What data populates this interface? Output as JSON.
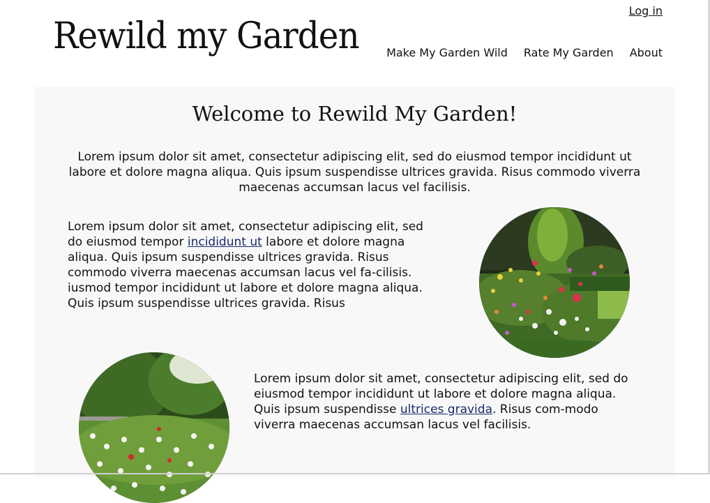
{
  "header": {
    "login_label": "Log in",
    "logo_text": "Rewild my Garden",
    "nav": [
      "Make My Garden Wild",
      "Rate My Garden",
      "About"
    ]
  },
  "main": {
    "title": "Welcome to Rewild My Garden!",
    "intro": "Lorem ipsum dolor sit amet, consectetur adipiscing elit, sed do eiusmod tempor incididunt ut labore et dolore magna aliqua. Quis ipsum suspendisse ultrices gravida. Risus commodo viverra maecenas accumsan lacus vel facilisis.",
    "section1": {
      "text_a": "Lorem ipsum dolor sit amet, consectetur adipiscing elit, sed do eiusmod tempor ",
      "link": "incididunt ut",
      "text_b": " labore et dolore magna aliqua. Quis ipsum suspendisse ultrices gravida. Risus commodo viverra maecenas accumsan lacus vel fa-cilisis.",
      "text_c": "iusmod tempor incididunt ut labore et dolore magna aliqua. Quis ipsum suspendisse ultrices gravida. Risus"
    },
    "section2": {
      "text_a": "Lorem ipsum dolor sit amet, consectetur adipiscing elit, sed do eiusmod tempor incididunt ut labore et dolore magna aliqua. Quis ipsum suspendisse ",
      "link": "ultrices gravida",
      "text_b": ". Risus com-modo viverra maecenas accumsan lacus vel facilisis."
    }
  },
  "colors": {
    "content_bg": "#f8f8f9",
    "link": "#1b2a6b",
    "text": "#111111"
  },
  "images": [
    "flower-garden-photo",
    "meadow-garden-photo"
  ]
}
